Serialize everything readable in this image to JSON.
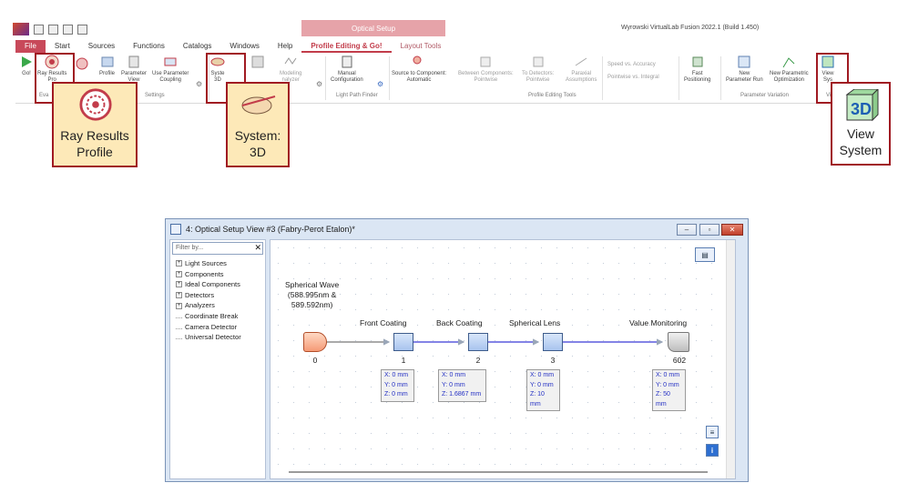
{
  "app": {
    "title": "Wyrowski VirtualLab Fusion 2022.1 (Build 1.450)",
    "context_tab_header": "Optical Setup"
  },
  "tabs": [
    "File",
    "Start",
    "Sources",
    "Functions",
    "Catalogs",
    "Windows",
    "Help",
    "Profile Editing & Go!",
    "Layout Tools"
  ],
  "ribbon": {
    "go": "Go!",
    "ray_results": "Ray Results",
    "ray_results_sub": "Pro",
    "evaluation_group": "Eva",
    "profile_label": "Profile",
    "parameter_label": "Parameter",
    "view_label": "View",
    "use_param": "Use Parameter",
    "coupling": "Coupling",
    "settings_group": "Settings",
    "system_3d": "Syste",
    "system_3d_sub": "3D",
    "modeling": "Modeling",
    "analyzer": "nalyzer",
    "manual": "Manual",
    "configuration": "Configuration",
    "light_path_group": "Light Path Finder",
    "source_to_component": "Source to Component:",
    "automatic": "Automatic",
    "between_components": "Between Components:",
    "pointwise": "Pointwise",
    "to_detectors": "To Detectors:",
    "pointwise2": "Pointwise",
    "paraxial": "Paraxial",
    "assumptions": "Assumptions",
    "profile_editing_group": "Profile Editing Tools",
    "speed_vs_accuracy": "Speed vs. Accuracy",
    "pointwise_vs_integral": "Pointwise vs. Integral",
    "fast": "Fast",
    "positioning": "Positioning",
    "new": "New",
    "parameter_run": "Parameter Run",
    "new_parametric": "New Parametric",
    "optimization": "Optimization",
    "param_variation_group": "Parameter Variation",
    "view_sys": "View",
    "view_sys_sub": "Sys",
    "view_group": "Vi"
  },
  "callouts": {
    "ray_results_profile": [
      "Ray Results",
      "Profile"
    ],
    "system_3d": [
      "System:",
      "3D"
    ],
    "view_system": [
      "View",
      "System"
    ]
  },
  "window": {
    "title": "4: Optical Setup View #3 (Fabry-Perot Etalon)*",
    "min": "–",
    "max": "▫",
    "close": "✕"
  },
  "catalog": {
    "filter_placeholder": "Filter by...",
    "items": [
      {
        "label": "Light Sources",
        "expandable": true
      },
      {
        "label": "Components",
        "expandable": true
      },
      {
        "label": "Ideal Components",
        "expandable": true
      },
      {
        "label": "Detectors",
        "expandable": true
      },
      {
        "label": "Analyzers",
        "expandable": true
      },
      {
        "label": "Coordinate Break",
        "expandable": false
      },
      {
        "label": "Camera Detector",
        "expandable": false
      },
      {
        "label": "Universal Detector",
        "expandable": false
      }
    ]
  },
  "setup": {
    "source": {
      "label": [
        "Spherical Wave",
        "(588.995nm &",
        "589.592nm)"
      ],
      "index": "0"
    },
    "components": [
      {
        "label": "Front Coating",
        "index": "1",
        "pos": [
          "X: 0 mm",
          "Y: 0 mm",
          "Z: 0 mm"
        ]
      },
      {
        "label": "Back Coating",
        "index": "2",
        "pos": [
          "X: 0 mm",
          "Y: 0 mm",
          "Z: 1.6867 mm"
        ]
      },
      {
        "label": "Spherical Lens",
        "index": "3",
        "pos": [
          "X: 0 mm",
          "Y: 0 mm",
          "Z: 10 mm"
        ]
      }
    ],
    "detector": {
      "label": "Value Monitoring",
      "index": "602",
      "pos": [
        "X: 0 mm",
        "Y: 0 mm",
        "Z: 50 mm"
      ]
    }
  },
  "colors": {
    "accent": "#c23c4a",
    "highlight": "#a01a22",
    "callout_fill": "#fde9b8",
    "position_text": "#2430c4",
    "link_line": "#3b3bd6"
  }
}
